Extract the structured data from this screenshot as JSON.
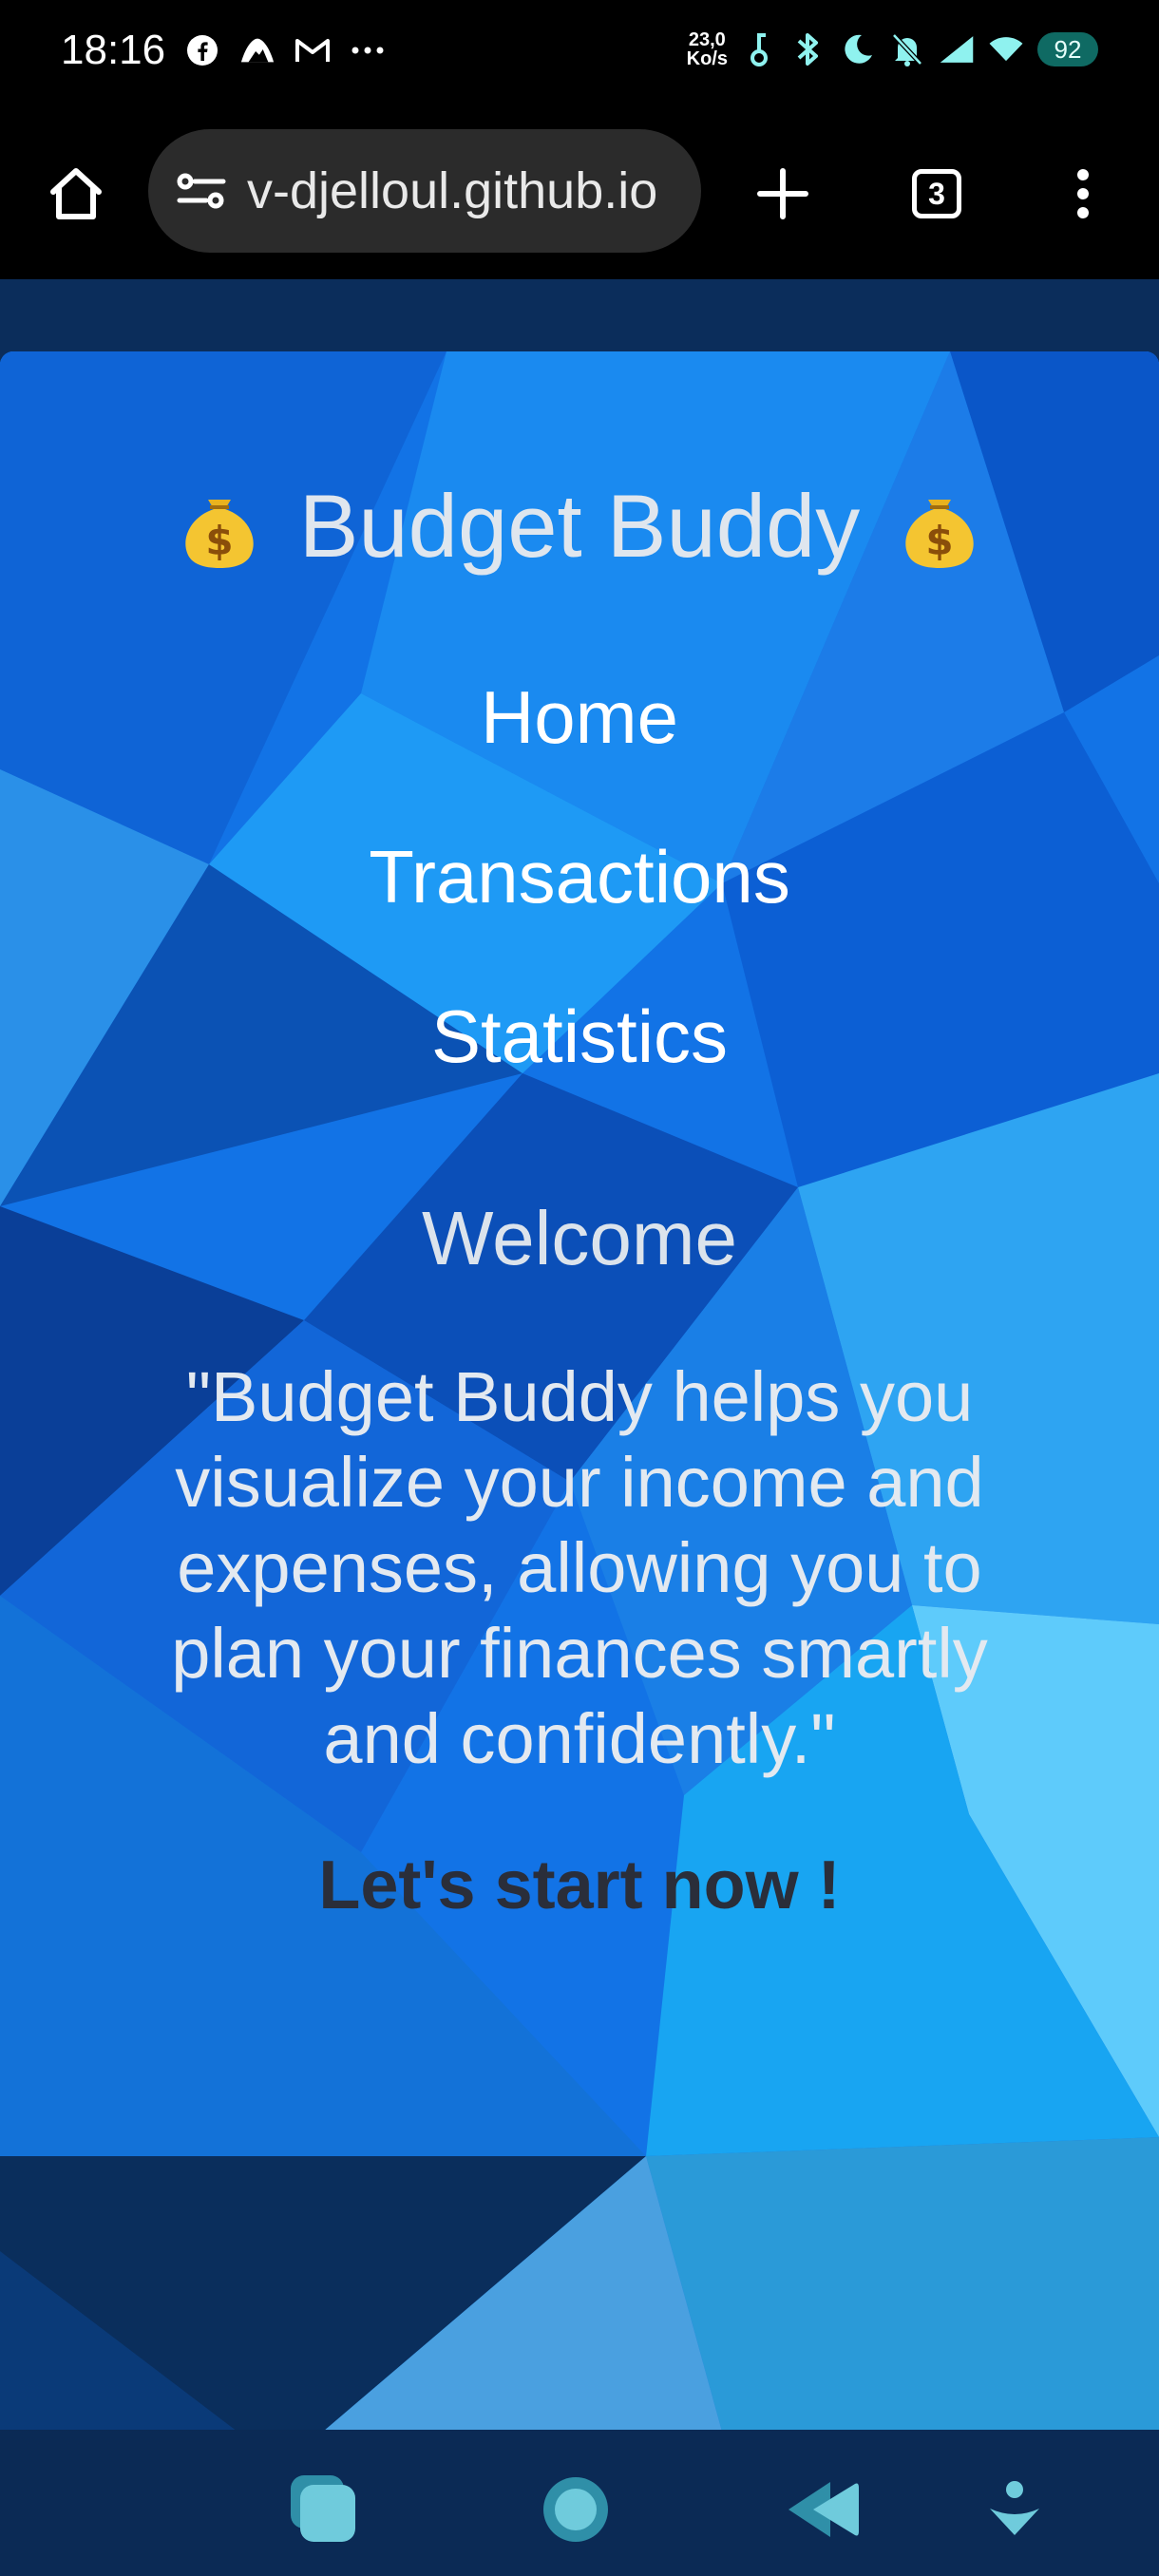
{
  "status_bar": {
    "time": "18:16",
    "net_speed_value": "23,0",
    "net_speed_unit": "Ko/s",
    "battery": "92",
    "left_icons": [
      "facebook-icon",
      "mountain-icon",
      "gmail-icon",
      "more-dots-icon"
    ],
    "right_icons": [
      "key-icon",
      "bluetooth-icon",
      "moon-icon",
      "bell-muted-icon",
      "signal-icon",
      "wifi-icon"
    ]
  },
  "browser": {
    "url": "v-djelloul.github.io",
    "tab_count": "3"
  },
  "site": {
    "title": "Budget Buddy",
    "nav": {
      "home": "Home",
      "transactions": "Transactions",
      "statistics": "Statistics"
    },
    "welcome": "Welcome",
    "tagline": "\"Budget Buddy helps you visualize your income and expenses, allowing you to plan your finances smartly and confidently.\"",
    "cta": "Let's start now !"
  },
  "colors": {
    "page_bg": "#0b2d5b",
    "accent_blue": "#1273e6",
    "cta_text": "#2a2e3a",
    "battery_bg": "#0f6a63"
  }
}
